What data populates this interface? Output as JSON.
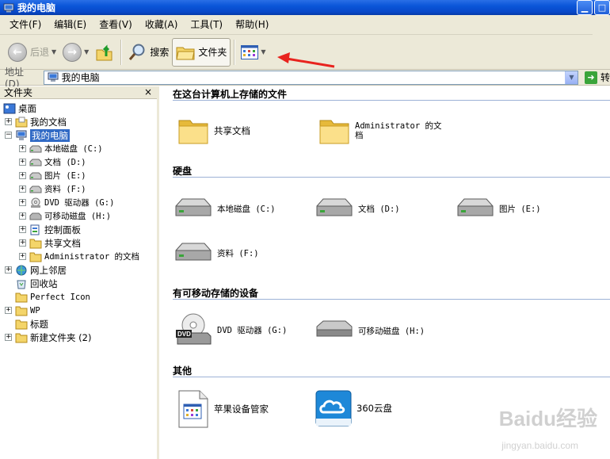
{
  "window": {
    "title": "我的电脑"
  },
  "menu": {
    "items": [
      "文件(F)",
      "编辑(E)",
      "查看(V)",
      "收藏(A)",
      "工具(T)",
      "帮助(H)"
    ]
  },
  "toolbar": {
    "back_label": "后退",
    "search_label": "搜索",
    "folders_label": "文件夹"
  },
  "address": {
    "label": "地址(D)",
    "value": "我的电脑",
    "go_label": "转"
  },
  "folders_pane": {
    "title": "文件夹",
    "close": "×",
    "tree": [
      {
        "label": "桌面"
      },
      {
        "label": "我的文档"
      },
      {
        "label": "我的电脑"
      },
      {
        "label": "本地磁盘 (C:)"
      },
      {
        "label": "文档 (D:)"
      },
      {
        "label": "图片 (E:)"
      },
      {
        "label": "资料 (F:)"
      },
      {
        "label": "DVD 驱动器 (G:)"
      },
      {
        "label": "可移动磁盘 (H:)"
      },
      {
        "label": "控制面板"
      },
      {
        "label": "共享文档"
      },
      {
        "label": "Administrator 的文档"
      },
      {
        "label": "网上邻居"
      },
      {
        "label": "回收站"
      },
      {
        "label": "Perfect Icon"
      },
      {
        "label": "WP"
      },
      {
        "label": "标题"
      },
      {
        "label": "新建文件夹 (2)"
      }
    ]
  },
  "content": {
    "groups": [
      {
        "title": "在这台计算机上存储的文件",
        "items": [
          "共享文档",
          "Administrator 的文档"
        ]
      },
      {
        "title": "硬盘",
        "items": [
          "本地磁盘 (C:)",
          "文档 (D:)",
          "图片 (E:)",
          "资料 (F:)"
        ]
      },
      {
        "title": "有可移动存储的设备",
        "items": [
          "DVD 驱动器 (G:)",
          "可移动磁盘 (H:)"
        ]
      },
      {
        "title": "其他",
        "items": [
          "苹果设备管家",
          "360云盘"
        ]
      }
    ]
  },
  "colors": {
    "titlebar": "#0a55d8",
    "selection": "#316ac5",
    "chrome": "#ece9d8"
  },
  "watermark": {
    "logo": "Baidu经验",
    "url": "jingyan.baidu.com"
  }
}
